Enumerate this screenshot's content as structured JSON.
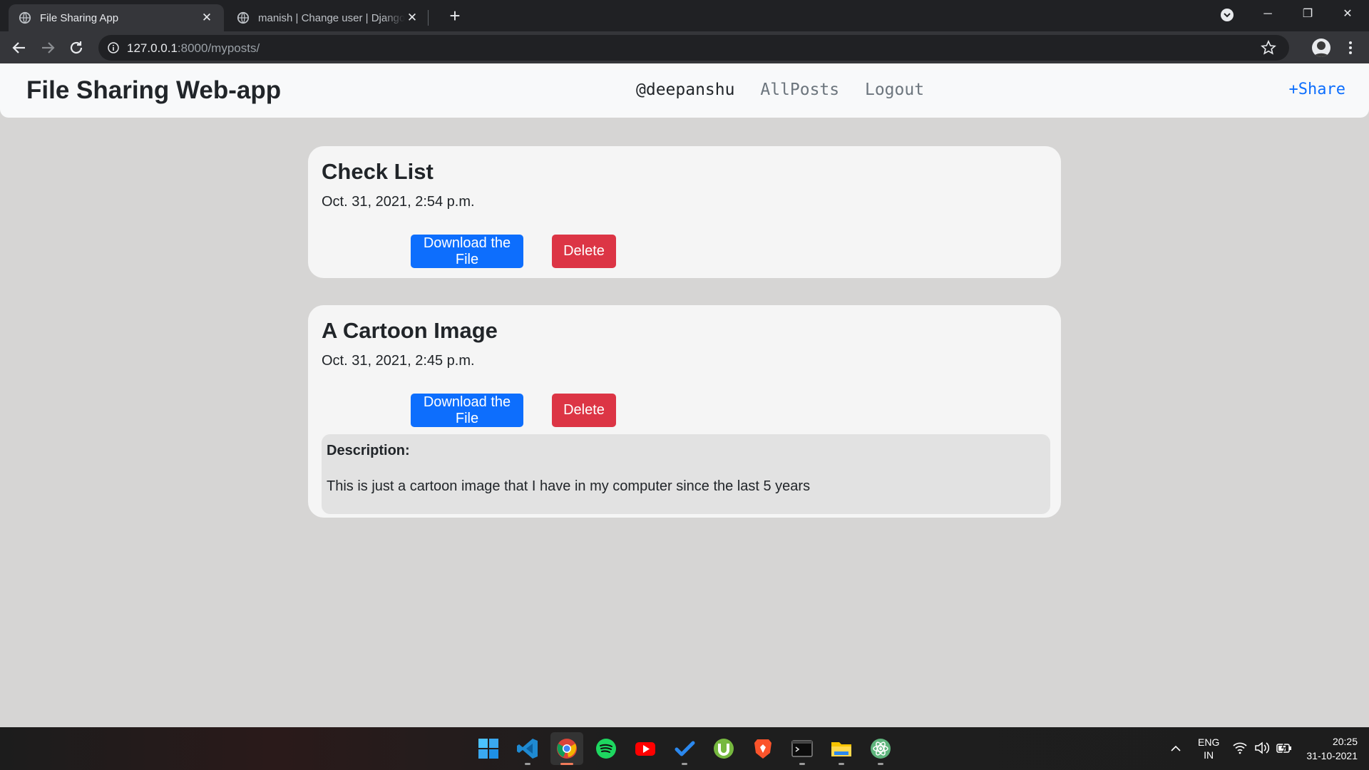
{
  "browser": {
    "tabs": [
      {
        "title": "File Sharing App",
        "active": true
      },
      {
        "title": "manish | Change user | Django site admin",
        "active": false
      }
    ],
    "url_host": "127.0.0.1",
    "url_rest": ":8000/myposts/"
  },
  "navbar": {
    "brand": "File Sharing Web-app",
    "user": "@deepanshu",
    "links": [
      "AllPosts",
      "Logout"
    ],
    "share": "+Share"
  },
  "posts": [
    {
      "title": "Check List",
      "date": "Oct. 31, 2021, 2:54 p.m.",
      "download_label": "Download the File",
      "delete_label": "Delete"
    },
    {
      "title": "A Cartoon Image",
      "date": "Oct. 31, 2021, 2:45 p.m.",
      "download_label": "Download the File",
      "delete_label": "Delete",
      "description_label": "Description:",
      "description": "This is just a cartoon image that I have in my computer since the last 5 years"
    }
  ],
  "taskbar": {
    "apps": [
      "windows-start-icon",
      "vscode-icon",
      "chrome-icon",
      "spotify-icon",
      "youtube-icon",
      "todo-icon",
      "utorrent-icon",
      "brave-icon",
      "terminal-icon",
      "file-explorer-icon",
      "atom-icon"
    ],
    "lang_top": "ENG",
    "lang_bottom": "IN",
    "time": "20:25",
    "date": "31-10-2021"
  },
  "colors": {
    "primary": "#0d6efd",
    "danger": "#dc3545",
    "page_bg": "#d6d5d4",
    "card_bg": "#f5f5f5"
  }
}
